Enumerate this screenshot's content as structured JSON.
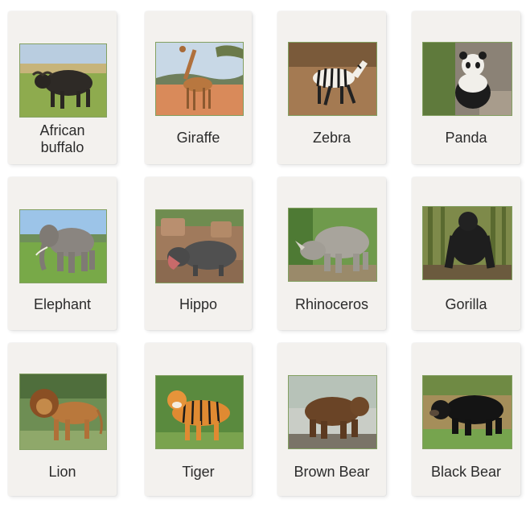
{
  "cards": [
    {
      "label_line1": "African",
      "label_line2": "buffalo",
      "animal": "african-buffalo"
    },
    {
      "label": "Giraffe",
      "animal": "giraffe"
    },
    {
      "label": "Zebra",
      "animal": "zebra"
    },
    {
      "label": "Panda",
      "animal": "panda"
    },
    {
      "label": "Elephant",
      "animal": "elephant"
    },
    {
      "label": "Hippo",
      "animal": "hippo"
    },
    {
      "label": "Rhinoceros",
      "animal": "rhinoceros"
    },
    {
      "label": "Gorilla",
      "animal": "gorilla"
    },
    {
      "label": "Lion",
      "animal": "lion"
    },
    {
      "label": "Tiger",
      "animal": "tiger"
    },
    {
      "label": "Brown Bear",
      "animal": "brown-bear"
    },
    {
      "label": "Black Bear",
      "animal": "black-bear"
    }
  ],
  "colors": {
    "card": "#f3f1ee",
    "label": "#2b2b2b",
    "background": "#ffffff"
  }
}
